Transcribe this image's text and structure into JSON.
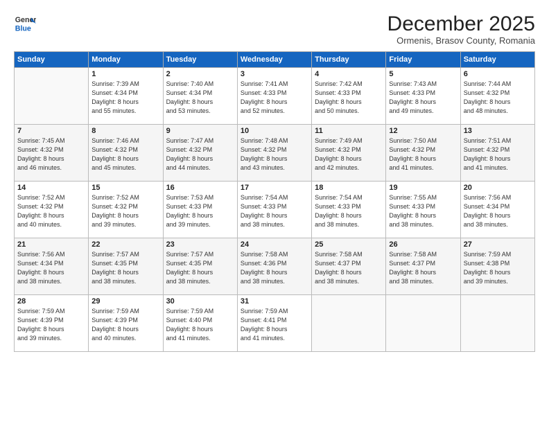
{
  "header": {
    "logo_general": "General",
    "logo_blue": "Blue",
    "month_title": "December 2025",
    "subtitle": "Ormenis, Brasov County, Romania"
  },
  "days_of_week": [
    "Sunday",
    "Monday",
    "Tuesday",
    "Wednesday",
    "Thursday",
    "Friday",
    "Saturday"
  ],
  "weeks": [
    [
      {
        "day": "",
        "info": ""
      },
      {
        "day": "1",
        "info": "Sunrise: 7:39 AM\nSunset: 4:34 PM\nDaylight: 8 hours\nand 55 minutes."
      },
      {
        "day": "2",
        "info": "Sunrise: 7:40 AM\nSunset: 4:34 PM\nDaylight: 8 hours\nand 53 minutes."
      },
      {
        "day": "3",
        "info": "Sunrise: 7:41 AM\nSunset: 4:33 PM\nDaylight: 8 hours\nand 52 minutes."
      },
      {
        "day": "4",
        "info": "Sunrise: 7:42 AM\nSunset: 4:33 PM\nDaylight: 8 hours\nand 50 minutes."
      },
      {
        "day": "5",
        "info": "Sunrise: 7:43 AM\nSunset: 4:33 PM\nDaylight: 8 hours\nand 49 minutes."
      },
      {
        "day": "6",
        "info": "Sunrise: 7:44 AM\nSunset: 4:32 PM\nDaylight: 8 hours\nand 48 minutes."
      }
    ],
    [
      {
        "day": "7",
        "info": "Sunrise: 7:45 AM\nSunset: 4:32 PM\nDaylight: 8 hours\nand 46 minutes."
      },
      {
        "day": "8",
        "info": "Sunrise: 7:46 AM\nSunset: 4:32 PM\nDaylight: 8 hours\nand 45 minutes."
      },
      {
        "day": "9",
        "info": "Sunrise: 7:47 AM\nSunset: 4:32 PM\nDaylight: 8 hours\nand 44 minutes."
      },
      {
        "day": "10",
        "info": "Sunrise: 7:48 AM\nSunset: 4:32 PM\nDaylight: 8 hours\nand 43 minutes."
      },
      {
        "day": "11",
        "info": "Sunrise: 7:49 AM\nSunset: 4:32 PM\nDaylight: 8 hours\nand 42 minutes."
      },
      {
        "day": "12",
        "info": "Sunrise: 7:50 AM\nSunset: 4:32 PM\nDaylight: 8 hours\nand 41 minutes."
      },
      {
        "day": "13",
        "info": "Sunrise: 7:51 AM\nSunset: 4:32 PM\nDaylight: 8 hours\nand 41 minutes."
      }
    ],
    [
      {
        "day": "14",
        "info": "Sunrise: 7:52 AM\nSunset: 4:32 PM\nDaylight: 8 hours\nand 40 minutes."
      },
      {
        "day": "15",
        "info": "Sunrise: 7:52 AM\nSunset: 4:32 PM\nDaylight: 8 hours\nand 39 minutes."
      },
      {
        "day": "16",
        "info": "Sunrise: 7:53 AM\nSunset: 4:33 PM\nDaylight: 8 hours\nand 39 minutes."
      },
      {
        "day": "17",
        "info": "Sunrise: 7:54 AM\nSunset: 4:33 PM\nDaylight: 8 hours\nand 38 minutes."
      },
      {
        "day": "18",
        "info": "Sunrise: 7:54 AM\nSunset: 4:33 PM\nDaylight: 8 hours\nand 38 minutes."
      },
      {
        "day": "19",
        "info": "Sunrise: 7:55 AM\nSunset: 4:33 PM\nDaylight: 8 hours\nand 38 minutes."
      },
      {
        "day": "20",
        "info": "Sunrise: 7:56 AM\nSunset: 4:34 PM\nDaylight: 8 hours\nand 38 minutes."
      }
    ],
    [
      {
        "day": "21",
        "info": "Sunrise: 7:56 AM\nSunset: 4:34 PM\nDaylight: 8 hours\nand 38 minutes."
      },
      {
        "day": "22",
        "info": "Sunrise: 7:57 AM\nSunset: 4:35 PM\nDaylight: 8 hours\nand 38 minutes."
      },
      {
        "day": "23",
        "info": "Sunrise: 7:57 AM\nSunset: 4:35 PM\nDaylight: 8 hours\nand 38 minutes."
      },
      {
        "day": "24",
        "info": "Sunrise: 7:58 AM\nSunset: 4:36 PM\nDaylight: 8 hours\nand 38 minutes."
      },
      {
        "day": "25",
        "info": "Sunrise: 7:58 AM\nSunset: 4:37 PM\nDaylight: 8 hours\nand 38 minutes."
      },
      {
        "day": "26",
        "info": "Sunrise: 7:58 AM\nSunset: 4:37 PM\nDaylight: 8 hours\nand 38 minutes."
      },
      {
        "day": "27",
        "info": "Sunrise: 7:59 AM\nSunset: 4:38 PM\nDaylight: 8 hours\nand 39 minutes."
      }
    ],
    [
      {
        "day": "28",
        "info": "Sunrise: 7:59 AM\nSunset: 4:39 PM\nDaylight: 8 hours\nand 39 minutes."
      },
      {
        "day": "29",
        "info": "Sunrise: 7:59 AM\nSunset: 4:39 PM\nDaylight: 8 hours\nand 40 minutes."
      },
      {
        "day": "30",
        "info": "Sunrise: 7:59 AM\nSunset: 4:40 PM\nDaylight: 8 hours\nand 41 minutes."
      },
      {
        "day": "31",
        "info": "Sunrise: 7:59 AM\nSunset: 4:41 PM\nDaylight: 8 hours\nand 41 minutes."
      },
      {
        "day": "",
        "info": ""
      },
      {
        "day": "",
        "info": ""
      },
      {
        "day": "",
        "info": ""
      }
    ]
  ]
}
